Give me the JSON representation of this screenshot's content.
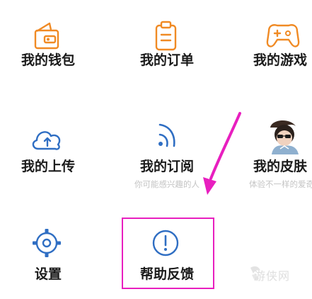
{
  "menu": {
    "wallet": {
      "label": "我的钱包",
      "icon": "wallet-icon"
    },
    "orders": {
      "label": "我的订单",
      "icon": "order-list-icon"
    },
    "games": {
      "label": "我的游戏",
      "icon": "gamepad-icon"
    },
    "uploads": {
      "label": "我的上传",
      "icon": "cloud-upload-icon"
    },
    "subscriptions": {
      "label": "我的订阅",
      "sub": "你可能感兴趣的人",
      "icon": "rss-icon"
    },
    "skins": {
      "label": "我的皮肤",
      "sub": "体验不一样的爱奇",
      "icon": "skin-avatar"
    },
    "settings": {
      "label": "设置",
      "icon": "gear-icon"
    },
    "feedback": {
      "label": "帮助反馈",
      "icon": "exclamation-circle-icon"
    }
  },
  "watermark": {
    "text": "游侠网"
  },
  "colors": {
    "accent": "#f08a24",
    "icon_blue": "#2f6ec3",
    "highlight": "#e81fbf",
    "sub_text": "#c4c4c4"
  }
}
